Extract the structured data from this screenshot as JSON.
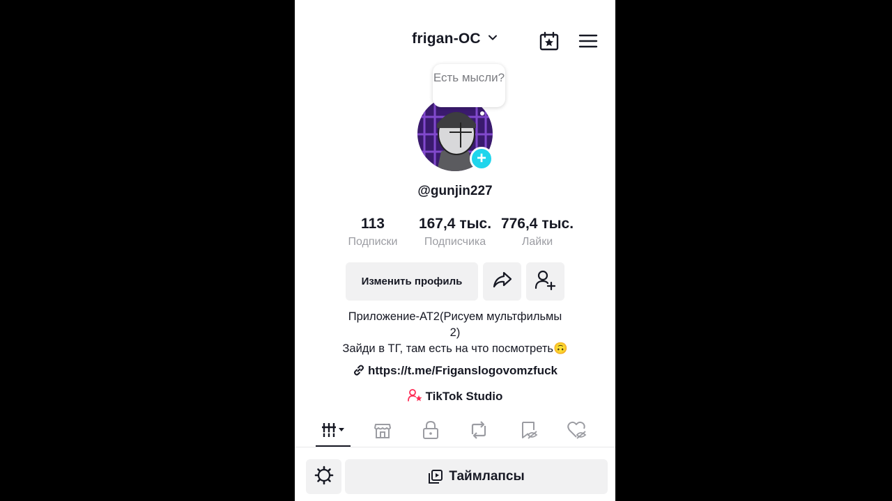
{
  "header": {
    "account_name": "frigan-OC",
    "icons": [
      "chevron-down-icon",
      "calendar-star-icon",
      "hamburger-menu-icon"
    ]
  },
  "profile": {
    "thought_bubble": "Есть мысли?",
    "username": "@gunjin227",
    "avatar_icon": "avatar-plus-icon"
  },
  "stats": [
    {
      "value": "113",
      "label": "Подписки"
    },
    {
      "value": "167,4 тыс.",
      "label": "Подписчика"
    },
    {
      "value": "776,4 тыс.",
      "label": "Лайки"
    }
  ],
  "actions": {
    "edit_profile": "Изменить профиль",
    "share_icon": "share-icon",
    "add_friend_icon": "add-friend-icon"
  },
  "bio": {
    "line1": "Приложение-АТ2(Рисуем мультфильмы",
    "line2": "2)",
    "line3": "Зайди в ТГ, там есть на что посмотреть🙃",
    "link": "https://t.me/Friganslogovomzfuck",
    "studio": "TikTok Studio"
  },
  "tabs": [
    "videos-grid-icon",
    "shop-icon",
    "private-lock-icon",
    "repost-icon",
    "favorites-hidden-icon",
    "liked-hidden-icon"
  ],
  "bottom": {
    "settings_icon": "settings-icon",
    "timelapse_label": "Таймлапсы"
  },
  "colors": {
    "accent_cyan": "#20d5ec",
    "text": "#161823",
    "muted": "#9b9ca2",
    "button_bg": "#f1f1f2",
    "studio_pink": "#fe2c55"
  }
}
